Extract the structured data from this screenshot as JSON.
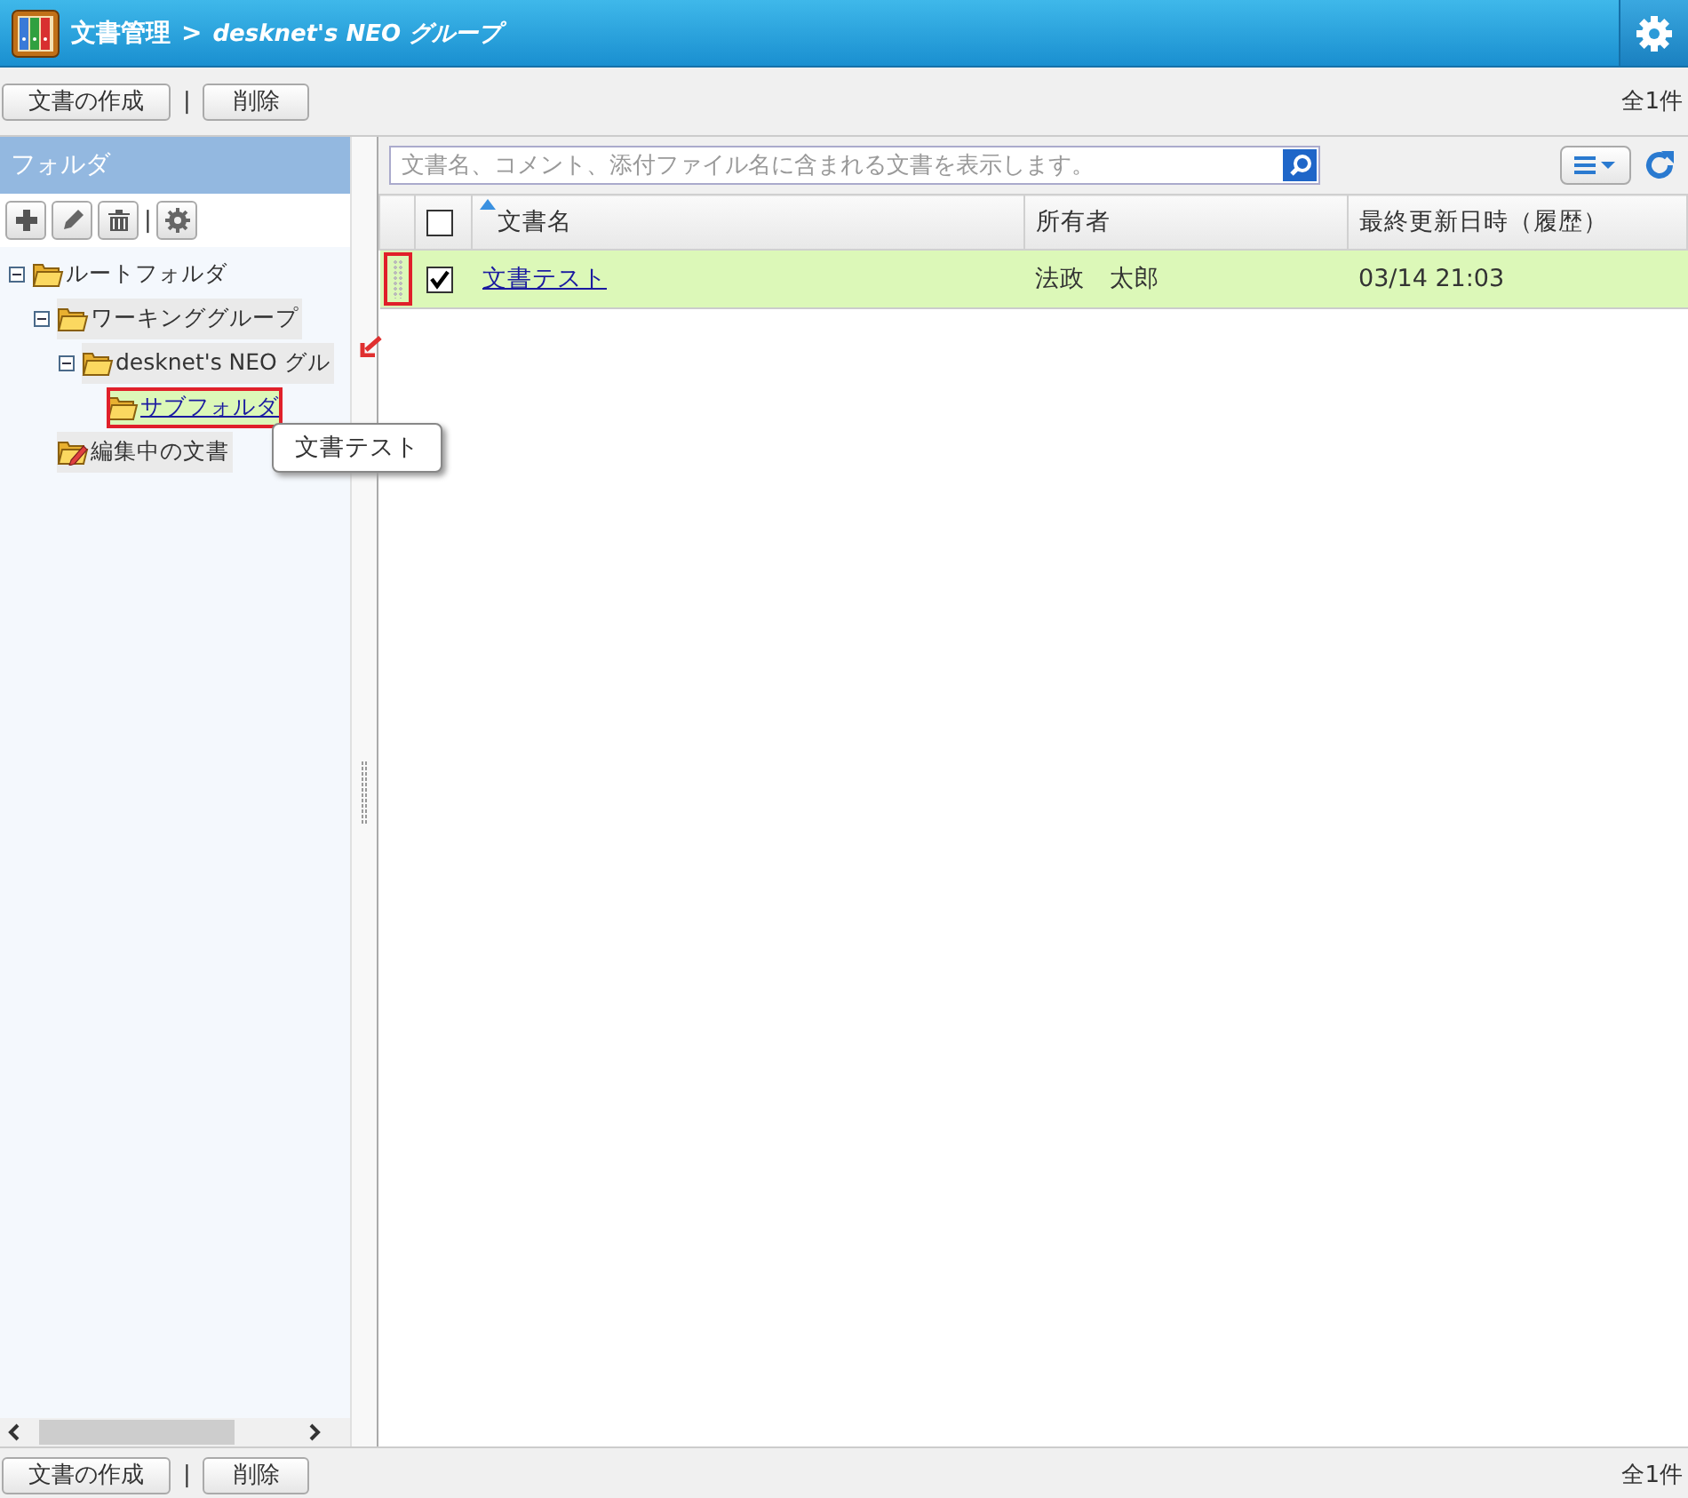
{
  "header": {
    "title": "文書管理",
    "separator": ">",
    "subtitle": "desknet's NEO グループ"
  },
  "top_toolbar": {
    "buttons": [
      "文書の作成",
      "削除"
    ],
    "separator": "|",
    "count": "全1件"
  },
  "sidebar": {
    "title": "フォルダ",
    "tools_separator": "|",
    "tree": [
      {
        "label": "ルートフォルダ",
        "kind": "folder",
        "expanded": true,
        "selected": false,
        "marked": false,
        "children": [
          {
            "label": "ワーキンググループ",
            "kind": "folder",
            "expanded": true,
            "selected": false,
            "marked": false,
            "children": [
              {
                "label": "desknet's NEO グル",
                "kind": "folder",
                "expanded": true,
                "selected": false,
                "marked": false,
                "children": [
                  {
                    "label": "サブフォルダ",
                    "kind": "folder",
                    "selected": true,
                    "marked": true
                  }
                ]
              }
            ]
          },
          {
            "label": "編集中の文書",
            "kind": "editing",
            "selected": false,
            "marked": false
          }
        ]
      }
    ]
  },
  "drag_ghost": {
    "label": "文書テスト"
  },
  "search": {
    "placeholder": "文書名、コメント、添付ファイル名に含まれる文書を表示します。"
  },
  "table": {
    "columns": [
      {
        "label": "文書名",
        "sorted": true
      },
      {
        "label": "所有者",
        "sorted": false
      },
      {
        "label": "最終更新日時（履歴）",
        "sorted": false
      }
    ],
    "header_checked": false,
    "rows": [
      {
        "name": "文書テスト",
        "owner": "法政　太郎",
        "updated": "03/14 21:03",
        "checked": true,
        "selected": true,
        "marked": true
      }
    ]
  },
  "bottom_toolbar": {
    "buttons": [
      "文書の作成",
      "削除"
    ],
    "separator": "|",
    "count": "全1件"
  }
}
